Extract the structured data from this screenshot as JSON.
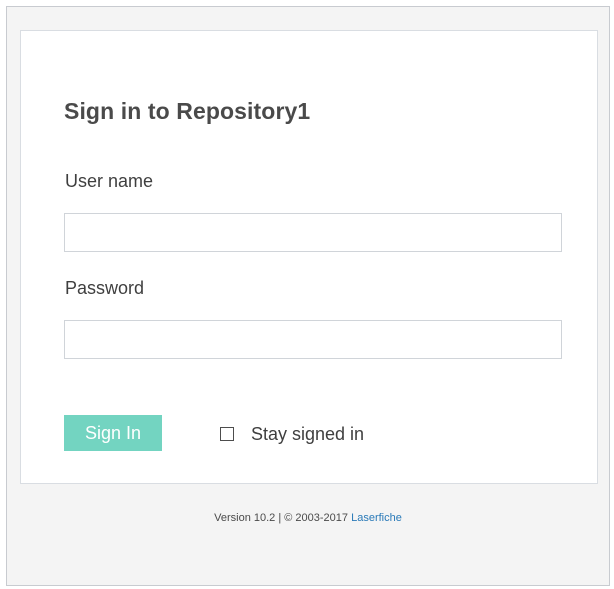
{
  "login": {
    "title": "Sign in to Repository1",
    "username_label": "User name",
    "username_value": "",
    "password_label": "Password",
    "password_value": "",
    "signin_button": "Sign In",
    "stay_signed_label": "Stay signed in",
    "stay_signed_checked": false
  },
  "footer": {
    "version_text": "Version 10.2",
    "separator": "|",
    "copyright_text": "© 2003-2017",
    "link_text": "Laserfiche"
  },
  "colors": {
    "page_background": "#f4f4f4",
    "panel_background": "#ffffff",
    "button_background": "#73d4c1",
    "button_text": "#ffffff",
    "link": "#2a7ab8"
  }
}
